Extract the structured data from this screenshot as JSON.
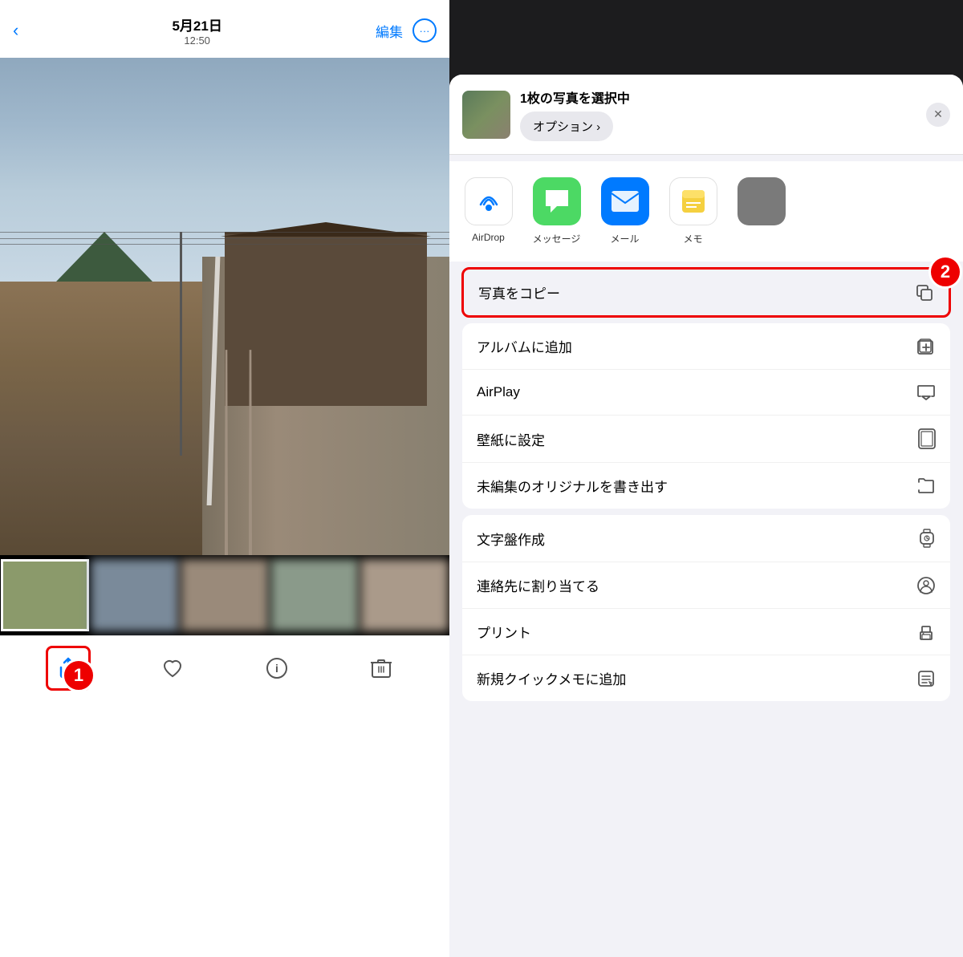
{
  "left_panel": {
    "nav": {
      "back_label": "‹",
      "date": "5月21日",
      "time": "12:50",
      "edit_label": "編集",
      "more_label": "···"
    },
    "toolbar": {
      "share_label": "共有",
      "heart_label": "♡",
      "info_label": "ⓘ",
      "trash_label": "🗑"
    },
    "badges": {
      "badge1": "1",
      "badge2": "2"
    }
  },
  "share_sheet": {
    "header": {
      "title": "1枚の写真を選択中",
      "options_label": "オプション ›",
      "close_label": "✕"
    },
    "apps": [
      {
        "id": "airdrop",
        "label": "AirDrop"
      },
      {
        "id": "messages",
        "label": "メッセージ"
      },
      {
        "id": "mail",
        "label": "メール"
      },
      {
        "id": "notes",
        "label": "メモ"
      }
    ],
    "actions_group1": [
      {
        "id": "copy-photo",
        "label": "写真をコピー",
        "icon": "⧉",
        "highlighted": true
      }
    ],
    "actions_group2": [
      {
        "id": "add-album",
        "label": "アルバムに追加",
        "icon": "⊕"
      },
      {
        "id": "airplay",
        "label": "AirPlay",
        "icon": "⬡"
      },
      {
        "id": "set-wallpaper",
        "label": "壁紙に設定",
        "icon": "▭"
      },
      {
        "id": "export-original",
        "label": "未編集のオリジナルを書き出す",
        "icon": "⬒"
      }
    ],
    "actions_group3": [
      {
        "id": "watch-face",
        "label": "文字盤作成",
        "icon": "⌚"
      },
      {
        "id": "assign-contact",
        "label": "連絡先に割り当てる",
        "icon": "👤"
      },
      {
        "id": "print",
        "label": "プリント",
        "icon": "🖨"
      },
      {
        "id": "quick-memo",
        "label": "新規クイックメモに追加",
        "icon": "📝"
      }
    ]
  }
}
